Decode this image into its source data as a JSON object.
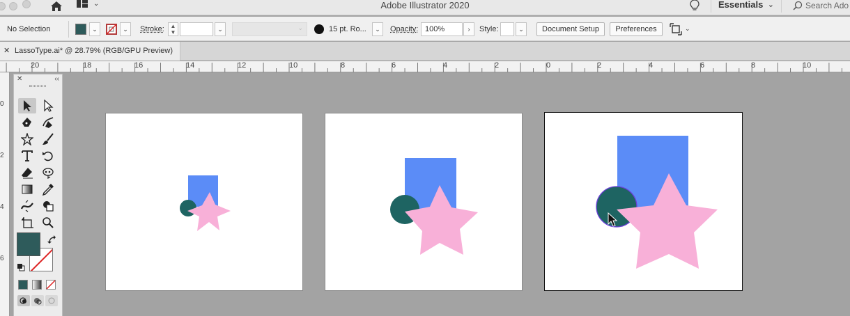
{
  "app": {
    "title": "Adobe Illustrator 2020",
    "workspace": "Essentials",
    "search_placeholder": "Search Ado"
  },
  "control_bar": {
    "selection_label": "No Selection",
    "fill_color": "#2e5b5b",
    "stroke_label": "Stroke:",
    "stroke_weight": "",
    "brush_label": "15 pt. Ro...",
    "opacity_label": "Opacity:",
    "opacity_value": "100%",
    "style_label": "Style:",
    "document_setup_label": "Document Setup",
    "preferences_label": "Preferences"
  },
  "document_tab": {
    "close_glyph": "✕",
    "title": "LassoType.ai* @ 28.79% (RGB/GPU Preview)"
  },
  "rulers": {
    "horizontal": [
      "20",
      "18",
      "16",
      "14",
      "12",
      "10",
      "8",
      "6",
      "4",
      "2",
      "0",
      "2",
      "4",
      "6",
      "8",
      "10"
    ],
    "vertical": [
      "0",
      "2",
      "4",
      "6"
    ]
  },
  "toolbar": {
    "close_glyph": "✕",
    "collapse_glyph": "‹‹",
    "tools": [
      "selection-tool",
      "direct-selection-tool",
      "pen-tool",
      "curvature-tool",
      "star-tool",
      "paintbrush-tool",
      "type-tool",
      "rotate-tool",
      "eraser-tool",
      "puppet-warp-tool",
      "gradient-tool",
      "eyedropper-tool",
      "width-tool",
      "shape-builder-tool",
      "artboard-tool",
      "zoom-tool"
    ]
  },
  "artwork": {
    "circle_color": "#1e6462",
    "square_color": "#5b8cf7",
    "star_color": "#f8b0d8",
    "active_artboard": 3
  }
}
